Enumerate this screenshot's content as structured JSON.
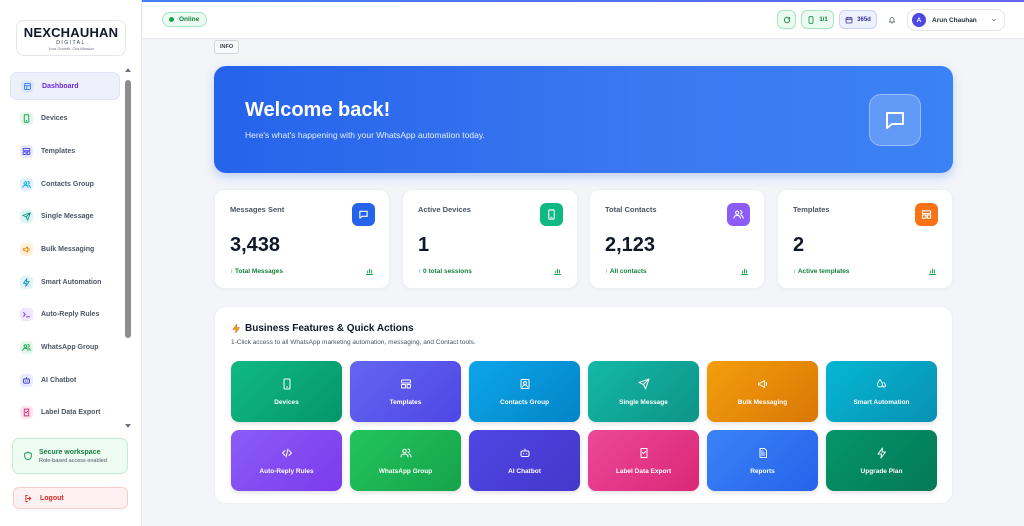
{
  "brand": {
    "logo_main": "NEXCHAUHAN",
    "logo_sub": "DIGITAL",
    "logo_tag": "Your Growth, Our Mission"
  },
  "sidebar": {
    "items": [
      {
        "label": "Dashboard",
        "icon": "dashboard-icon",
        "color": "#3b82f6",
        "bg": "#dbe7ff"
      },
      {
        "label": "Devices",
        "icon": "phone-icon",
        "color": "#16a34a",
        "bg": "#e3f7ea"
      },
      {
        "label": "Templates",
        "icon": "template-icon",
        "color": "#4f46e5",
        "bg": "#e6e9ff"
      },
      {
        "label": "Contacts Group",
        "icon": "users-icon",
        "color": "#0ea5e9",
        "bg": "#e0f2fe"
      },
      {
        "label": "Single Message",
        "icon": "send-icon",
        "color": "#0d9488",
        "bg": "#dcf5f1"
      },
      {
        "label": "Bulk Messaging",
        "icon": "megaphone-icon",
        "color": "#ea8a0c",
        "bg": "#fff1db"
      },
      {
        "label": "Smart Automation",
        "icon": "bolt-icon",
        "color": "#0891b2",
        "bg": "#dff4f8"
      },
      {
        "label": "Auto-Reply Rules",
        "icon": "terminal-icon",
        "color": "#7c3aed",
        "bg": "#efe6ff"
      },
      {
        "label": "WhatsApp Group",
        "icon": "group-icon",
        "color": "#16a34a",
        "bg": "#e3f7ea"
      },
      {
        "label": "AI Chatbot",
        "icon": "bot-icon",
        "color": "#4338ca",
        "bg": "#e6e9ff"
      },
      {
        "label": "Label Data Export",
        "icon": "export-icon",
        "color": "#db2777",
        "bg": "#fde4ef"
      }
    ],
    "secure_title": "Secure workspace",
    "secure_sub": "Role-based access enabled",
    "logout": "Logout"
  },
  "header": {
    "status": "Online",
    "device_count": "1/1",
    "days": "365d",
    "user_initial": "A",
    "user_name": "Arun Chauhan"
  },
  "info_tag": "INFO",
  "hero": {
    "title": "Welcome back!",
    "subtitle": "Here's what's happening with your WhatsApp automation today."
  },
  "stats": [
    {
      "title": "Messages Sent",
      "value": "3,438",
      "foot": "↑ Total Messages",
      "icon": "chat-icon",
      "color": "#2563eb"
    },
    {
      "title": "Active Devices",
      "value": "1",
      "foot": "↑ 0 total sessions",
      "icon": "phone-icon",
      "color": "#10b981"
    },
    {
      "title": "Total Contacts",
      "value": "2,123",
      "foot": "↑ All contacts",
      "icon": "users-icon",
      "color": "#8b5cf6"
    },
    {
      "title": "Templates",
      "value": "2",
      "foot": "↑ Active templates",
      "icon": "template-icon",
      "color": "#f97316"
    }
  ],
  "features": {
    "title": "Business Features & Quick Actions",
    "subtitle": "1-Click access to all WhatsApp marketing automation, messaging, and Contact tools.",
    "tiles": [
      {
        "label": "Devices",
        "icon": "phone-icon",
        "c1": "#10b981",
        "c2": "#059669"
      },
      {
        "label": "Templates",
        "icon": "template-icon",
        "c1": "#6366f1",
        "c2": "#4f46e5"
      },
      {
        "label": "Contacts Group",
        "icon": "contact-card-icon",
        "c1": "#0ea5e9",
        "c2": "#0284c7"
      },
      {
        "label": "Single Message",
        "icon": "send-icon",
        "c1": "#14b8a6",
        "c2": "#0d9488"
      },
      {
        "label": "Bulk Messaging",
        "icon": "megaphone-icon",
        "c1": "#f59e0b",
        "c2": "#d97706"
      },
      {
        "label": "Smart Automation",
        "icon": "drops-icon",
        "c1": "#06b6d4",
        "c2": "#0891b2"
      },
      {
        "label": "Auto-Reply Rules",
        "icon": "code-icon",
        "c1": "#8b5cf6",
        "c2": "#7c3aed"
      },
      {
        "label": "WhatsApp Group",
        "icon": "group-icon",
        "c1": "#22c55e",
        "c2": "#16a34a"
      },
      {
        "label": "AI Chatbot",
        "icon": "bot-icon",
        "c1": "#4f46e5",
        "c2": "#4338ca"
      },
      {
        "label": "Label Data Export",
        "icon": "export-icon",
        "c1": "#ec4899",
        "c2": "#db2777"
      },
      {
        "label": "Reports",
        "icon": "report-icon",
        "c1": "#3b82f6",
        "c2": "#2563eb"
      },
      {
        "label": "Upgrade Plan",
        "icon": "bolt-icon",
        "c1": "#059669",
        "c2": "#047857"
      }
    ]
  }
}
